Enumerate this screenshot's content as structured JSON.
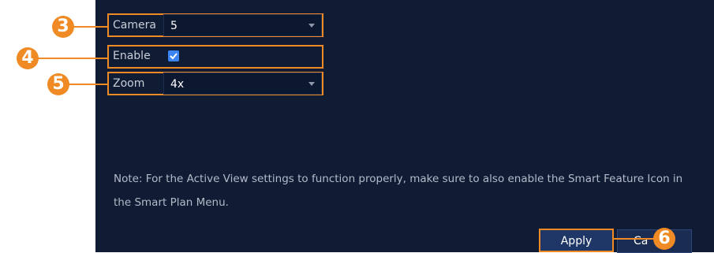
{
  "fields": {
    "camera": {
      "label": "Camera",
      "value": "5"
    },
    "enable": {
      "label": "Enable",
      "checked": true
    },
    "zoom": {
      "label": "Zoom",
      "value": "4x"
    }
  },
  "note": "Note: For the Active View settings to function properly, make sure to also enable the Smart Feature Icon in the Smart Plan Menu.",
  "buttons": {
    "apply": "Apply",
    "cancel": "Ca"
  },
  "callouts": [
    "3",
    "4",
    "5",
    "6"
  ],
  "colors": {
    "accent": "#f08a24",
    "panel": "#0f1c34",
    "checkbox": "#3b84f3"
  }
}
